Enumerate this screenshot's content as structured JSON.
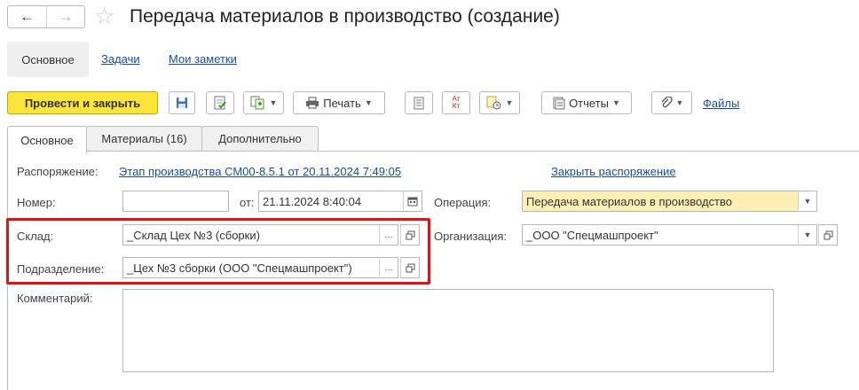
{
  "window": {
    "title": "Передача материалов в производство (создание)"
  },
  "form_tabs": [
    {
      "label": "Основное"
    },
    {
      "label": "Задачи"
    },
    {
      "label": "Мои заметки"
    }
  ],
  "toolbar": {
    "post_close_label": "Провести и закрыть",
    "print_label": "Печать",
    "reports_label": "Отчеты",
    "files_label": "Файлы",
    "dt_label": "Ат",
    "kt_label": "Кт"
  },
  "tabs": [
    {
      "label": "Основное"
    },
    {
      "label": "Материалы (16)"
    },
    {
      "label": "Дополнительно"
    }
  ],
  "form": {
    "order_label": "Распоряжение:",
    "order_value": "Этап производства СМ00-8.5.1 от 20.11.2024 7:49:05",
    "close_order_label": "Закрыть распоряжение",
    "number_label": "Номер:",
    "number_value": "",
    "date_label": "от:",
    "date_value": "21.11.2024  8:40:04",
    "operation_label": "Операция:",
    "operation_value": "Передача материалов в производство",
    "warehouse_label": "Склад:",
    "warehouse_value": "_Склад Цех №3 (сборки)",
    "organization_label": "Организация:",
    "organization_value": "_ООО \"Спецмашпроект\"",
    "department_label": "Подразделение:",
    "department_value": "_Цех №3 сборки (ООО \"Спецмашпроект\")",
    "comment_label": "Комментарий:",
    "comment_value": ""
  },
  "colors": {
    "accent_yellow": "#fbe53a",
    "field_yellow": "#fcefb4",
    "link_blue": "#1a4aa8",
    "highlight_red": "#e01414"
  }
}
